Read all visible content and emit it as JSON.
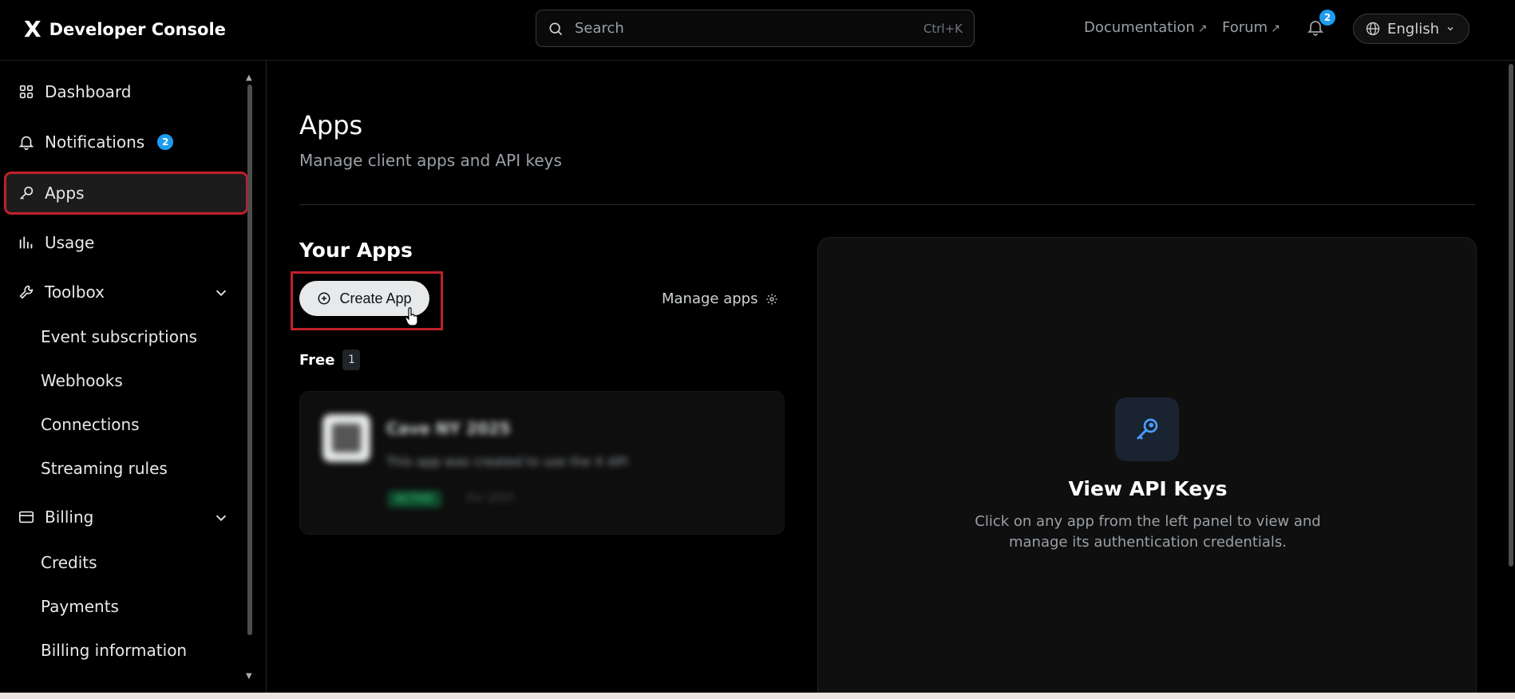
{
  "header": {
    "brand_logo": "X",
    "brand_title": "Developer Console",
    "search_placeholder": "Search",
    "search_shortcut": "Ctrl+K",
    "documentation_label": "Documentation",
    "forum_label": "Forum",
    "link_arrow": "↗",
    "notifications_count": "2",
    "language_label": "English"
  },
  "sidebar": {
    "dashboard": "Dashboard",
    "notifications": "Notifications",
    "notifications_badge": "2",
    "apps": "Apps",
    "usage": "Usage",
    "toolbox": "Toolbox",
    "toolbox_items": [
      "Event subscriptions",
      "Webhooks",
      "Connections",
      "Streaming rules"
    ],
    "billing": "Billing",
    "billing_items": [
      "Credits",
      "Payments",
      "Billing information"
    ]
  },
  "main": {
    "title": "Apps",
    "subtitle": "Manage client apps and API keys",
    "section_title": "Your Apps",
    "create_app_label": "Create App",
    "manage_apps_label": "Manage apps",
    "tier_label": "Free",
    "tier_count": "1",
    "app_card": {
      "name": "Cave NY 2025",
      "description": "This app was created to use the X API",
      "status": "ACTIVE",
      "meta": "Oct 2025"
    },
    "keys_panel": {
      "title": "View API Keys",
      "description": "Click on any app from the left panel to view and manage its authentication credentials."
    }
  },
  "colors": {
    "accent": "#1d9bf0",
    "highlight_outline": "#c0202a",
    "background": "#000000"
  }
}
